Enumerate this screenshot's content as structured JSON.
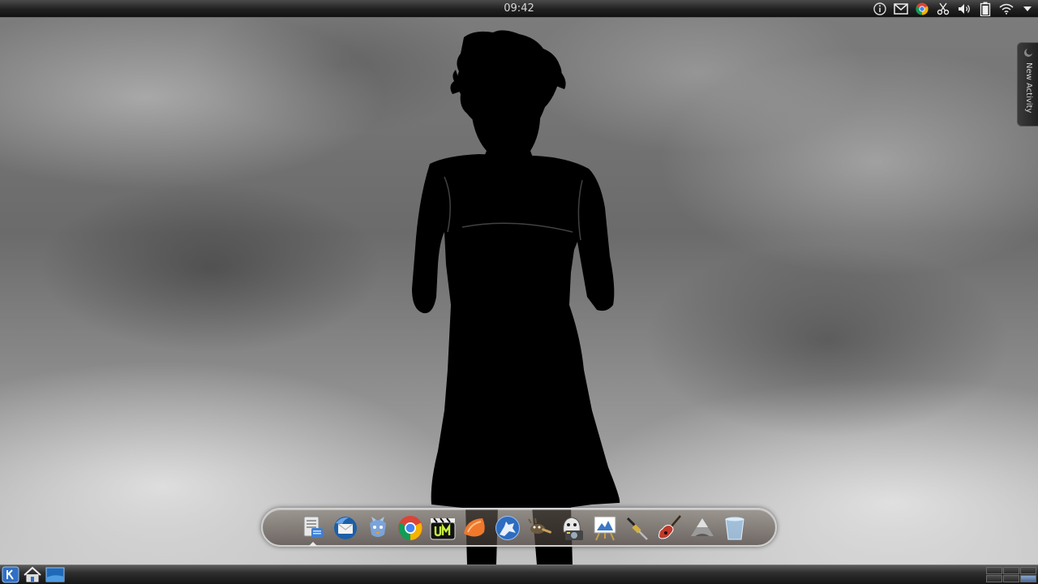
{
  "top_panel": {
    "clock": "09:42",
    "tray": [
      {
        "name": "info-icon"
      },
      {
        "name": "mail-icon"
      },
      {
        "name": "chrome-icon"
      },
      {
        "name": "scissors-icon"
      },
      {
        "name": "volume-icon"
      },
      {
        "name": "battery-icon"
      },
      {
        "name": "wifi-icon"
      },
      {
        "name": "tray-expand-icon"
      }
    ]
  },
  "activity_tab": {
    "label": "New Activity"
  },
  "dock": {
    "apps": [
      {
        "name": "file-manager-icon",
        "running": true
      },
      {
        "name": "thunderbird-icon",
        "running": false
      },
      {
        "name": "pidgin-icon",
        "running": false
      },
      {
        "name": "chrome-icon",
        "running": false
      },
      {
        "name": "umplayer-icon",
        "running": false
      },
      {
        "name": "clementine-icon",
        "running": false
      },
      {
        "name": "wolf-browser-icon",
        "running": false
      },
      {
        "name": "gimp-icon",
        "running": false
      },
      {
        "name": "screenshot-tool-icon",
        "running": false
      },
      {
        "name": "presentation-icon",
        "running": false
      },
      {
        "name": "audio-cable-icon",
        "running": false
      },
      {
        "name": "guitar-icon",
        "running": false
      },
      {
        "name": "inkscape-icon",
        "running": false
      },
      {
        "name": "trash-icon",
        "running": false
      }
    ]
  },
  "bottom_panel": {
    "items": [
      {
        "name": "kickoff-launcher-icon"
      },
      {
        "name": "home-folder-icon"
      },
      {
        "name": "show-desktop-icon"
      }
    ],
    "pager": {
      "desktops": 6,
      "active": 5
    }
  },
  "colors": {
    "panel": "#1a1a1a",
    "clock_text": "#d8d8d8",
    "dock_border": "#cfcfcf"
  }
}
